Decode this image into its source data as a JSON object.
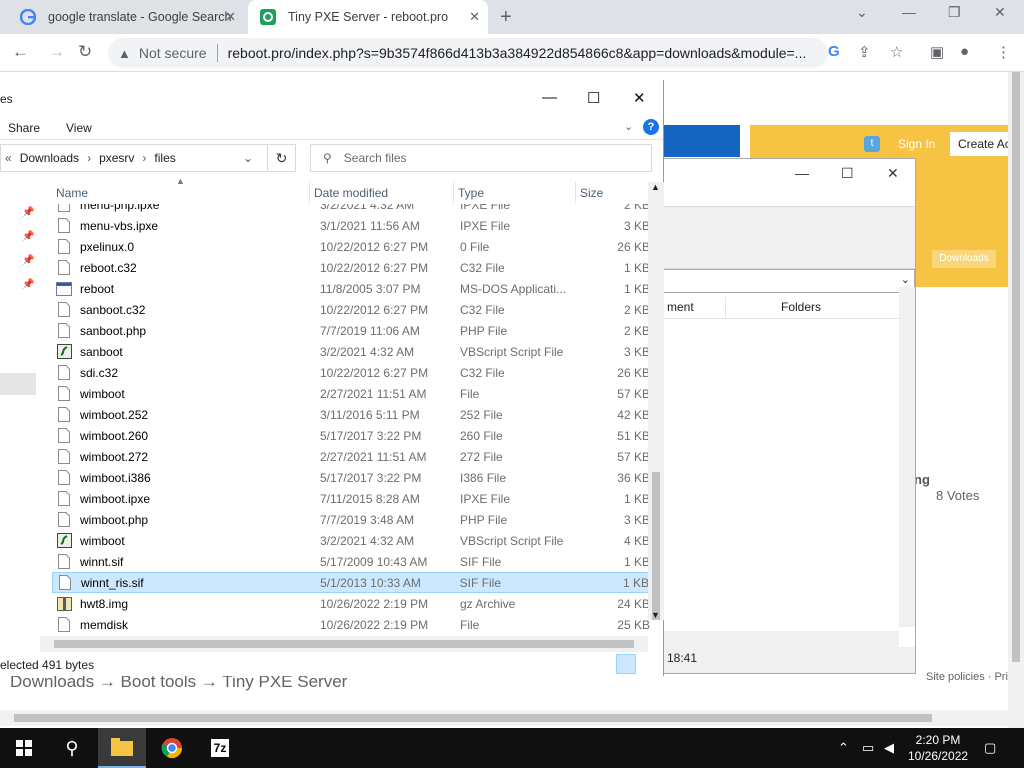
{
  "browser": {
    "tabs": [
      {
        "title": "google translate - Google Search",
        "icon": "google-icon"
      },
      {
        "title": "Tiny PXE Server - reboot.pro",
        "icon": "reboot-icon"
      }
    ],
    "security_label": "Not secure",
    "url": "reboot.pro/index.php?s=9b3574f866d413b3a384922d854866c8&app=downloads&module=..."
  },
  "webpage": {
    "sign_in": "Sign In",
    "create_account": "Create Ac",
    "downloads_button": "Downloads",
    "breadcrumb": "Downloads  →  Boot tools  →  Tiny PXE Server",
    "votes_prefix": "ng",
    "votes": "8 Votes",
    "site_policies": "Site policies · Pri"
  },
  "dialog": {
    "column_1": "ment",
    "column_2": "Folders",
    "status_time": "18:41"
  },
  "explorer": {
    "title": "es",
    "ribbon": [
      "Share",
      "View"
    ],
    "address": [
      "Downloads",
      "pxesrv",
      "files"
    ],
    "search_placeholder": "Search files",
    "columns": [
      "Name",
      "Date modified",
      "Type",
      "Size"
    ],
    "files": [
      {
        "name": "menu-php.ipxe",
        "date": "3/2/2021 4:32 AM",
        "type": "IPXE File",
        "size": "2 KB",
        "icon": "file-icon"
      },
      {
        "name": "menu-vbs.ipxe",
        "date": "3/1/2021 11:56 AM",
        "type": "IPXE File",
        "size": "3 KB",
        "icon": "file-icon"
      },
      {
        "name": "pxelinux.0",
        "date": "10/22/2012 6:27 PM",
        "type": "0 File",
        "size": "26 KB",
        "icon": "file-icon"
      },
      {
        "name": "reboot.c32",
        "date": "10/22/2012 6:27 PM",
        "type": "C32 File",
        "size": "1 KB",
        "icon": "file-icon"
      },
      {
        "name": "reboot",
        "date": "11/8/2005 3:07 PM",
        "type": "MS-DOS Applicati...",
        "size": "1 KB",
        "icon": "app-icon"
      },
      {
        "name": "sanboot.c32",
        "date": "10/22/2012 6:27 PM",
        "type": "C32 File",
        "size": "2 KB",
        "icon": "file-icon"
      },
      {
        "name": "sanboot.php",
        "date": "7/7/2019 11:06 AM",
        "type": "PHP File",
        "size": "2 KB",
        "icon": "file-icon"
      },
      {
        "name": "sanboot",
        "date": "3/2/2021 4:32 AM",
        "type": "VBScript Script File",
        "size": "3 KB",
        "icon": "script-icon"
      },
      {
        "name": "sdi.c32",
        "date": "10/22/2012 6:27 PM",
        "type": "C32 File",
        "size": "26 KB",
        "icon": "file-icon"
      },
      {
        "name": "wimboot",
        "date": "2/27/2021 11:51 AM",
        "type": "File",
        "size": "57 KB",
        "icon": "file-icon"
      },
      {
        "name": "wimboot.252",
        "date": "3/11/2016 5:11 PM",
        "type": "252 File",
        "size": "42 KB",
        "icon": "file-icon"
      },
      {
        "name": "wimboot.260",
        "date": "5/17/2017 3:22 PM",
        "type": "260 File",
        "size": "51 KB",
        "icon": "file-icon"
      },
      {
        "name": "wimboot.272",
        "date": "2/27/2021 11:51 AM",
        "type": "272 File",
        "size": "57 KB",
        "icon": "file-icon"
      },
      {
        "name": "wimboot.i386",
        "date": "5/17/2017 3:22 PM",
        "type": "I386 File",
        "size": "36 KB",
        "icon": "file-icon"
      },
      {
        "name": "wimboot.ipxe",
        "date": "7/11/2015 8:28 AM",
        "type": "IPXE File",
        "size": "1 KB",
        "icon": "file-icon"
      },
      {
        "name": "wimboot.php",
        "date": "7/7/2019 3:48 AM",
        "type": "PHP File",
        "size": "3 KB",
        "icon": "file-icon"
      },
      {
        "name": "wimboot",
        "date": "3/2/2021 4:32 AM",
        "type": "VBScript Script File",
        "size": "4 KB",
        "icon": "script-icon"
      },
      {
        "name": "winnt.sif",
        "date": "5/17/2009 10:43 AM",
        "type": "SIF File",
        "size": "1 KB",
        "icon": "file-icon"
      },
      {
        "name": "winnt_ris.sif",
        "date": "5/1/2013 10:33 AM",
        "type": "SIF File",
        "size": "1 KB",
        "icon": "file-icon",
        "selected": true
      },
      {
        "name": "hwt8.img",
        "date": "10/26/2022 2:19 PM",
        "type": "gz Archive",
        "size": "24 KB",
        "icon": "archive-icon"
      },
      {
        "name": "memdisk",
        "date": "10/26/2022 2:19 PM",
        "type": "File",
        "size": "25 KB",
        "icon": "file-icon"
      }
    ],
    "status": "elected  491 bytes"
  },
  "taskbar": {
    "time": "2:20 PM",
    "date": "10/26/2022"
  }
}
